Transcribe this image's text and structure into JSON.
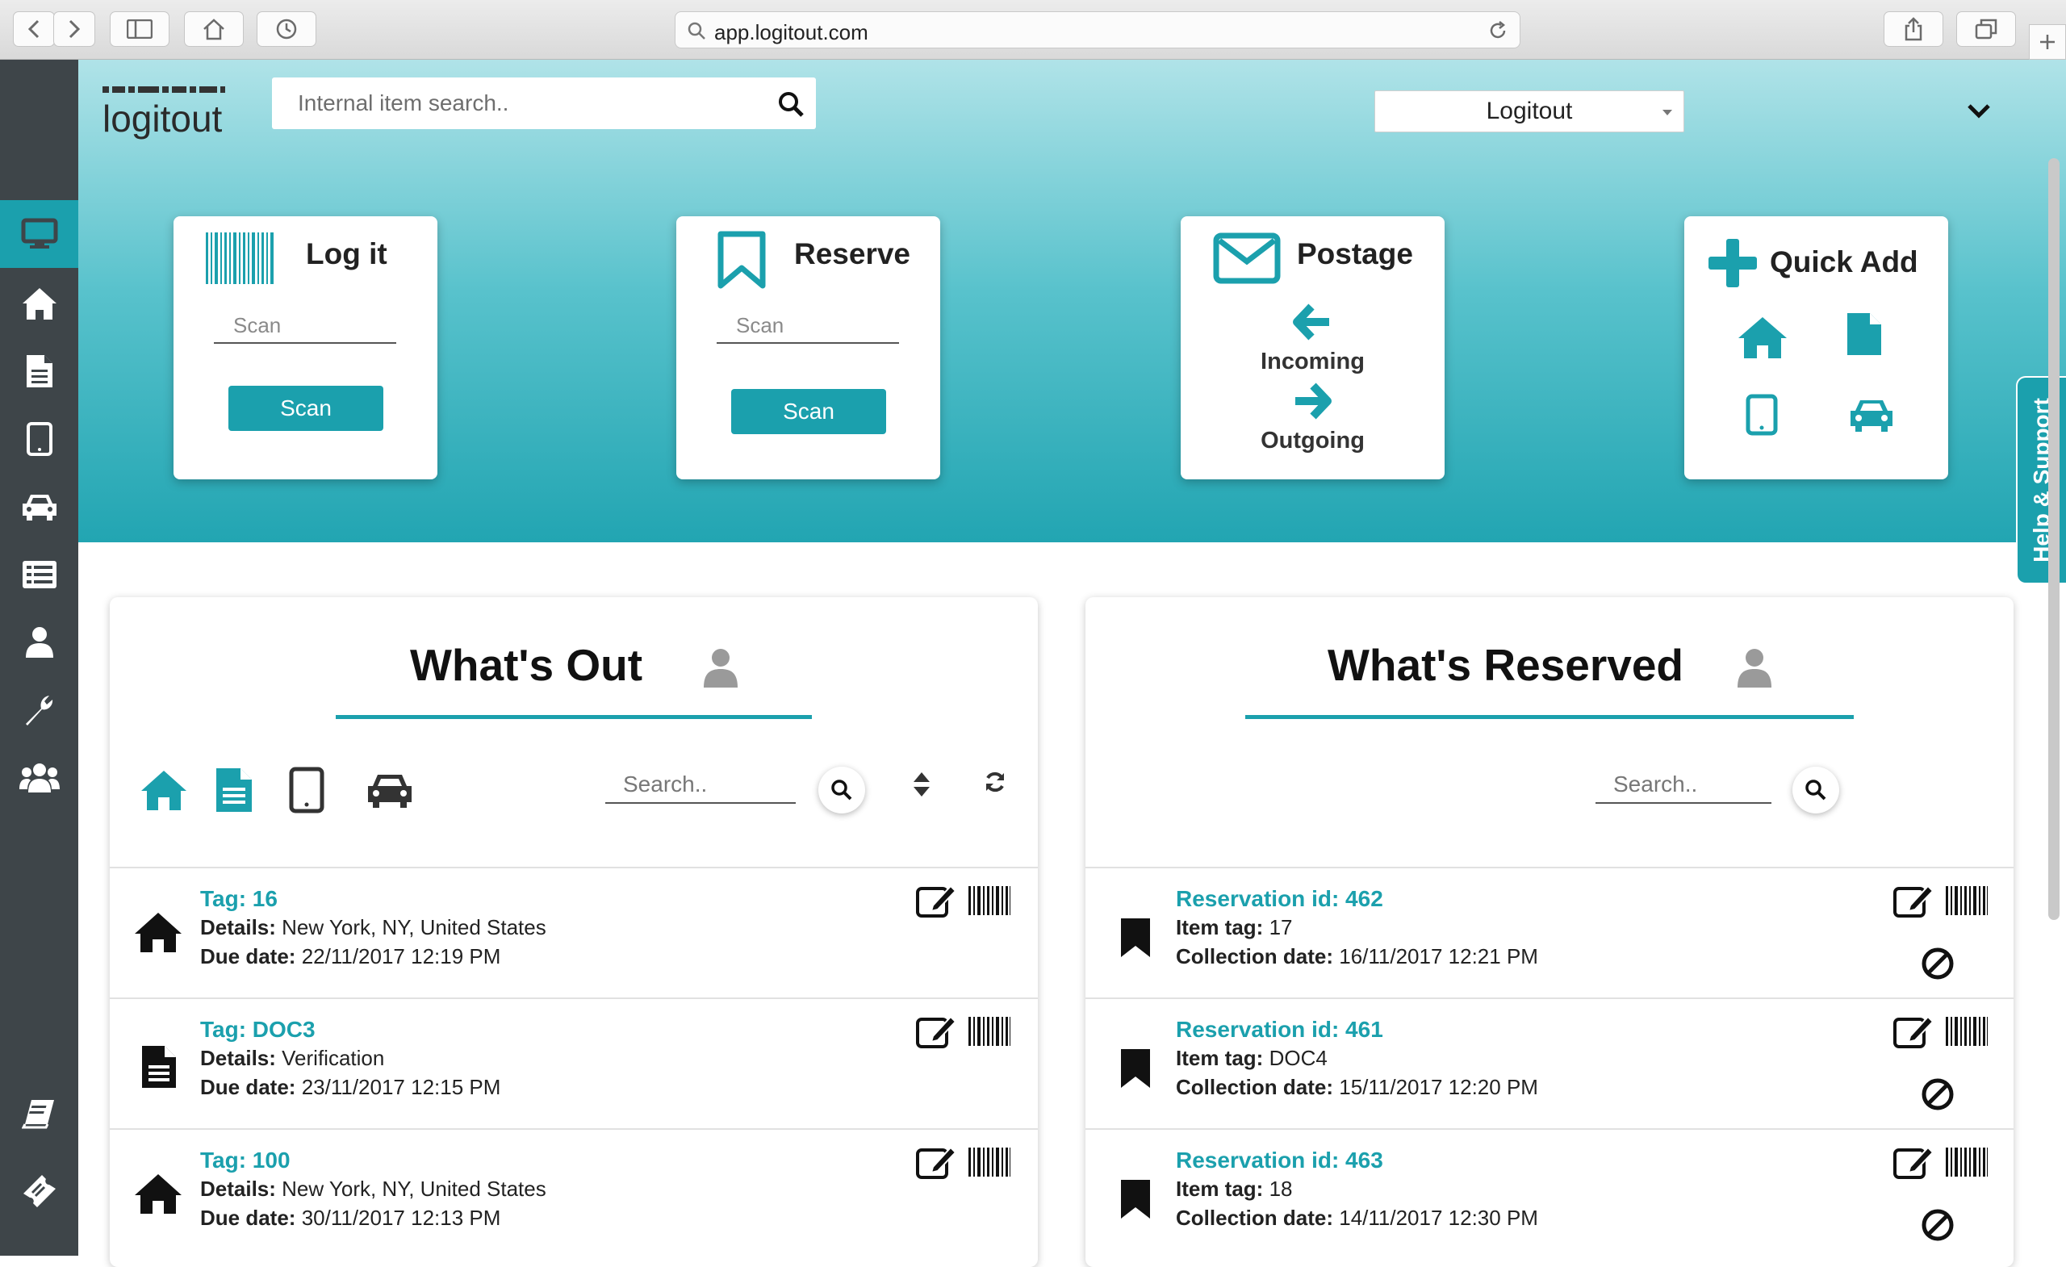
{
  "browser": {
    "url": "app.logitout.com"
  },
  "brand": {
    "logo_text": "logitout",
    "accent": "#1ba0ad",
    "rail_bg": "#3e4549"
  },
  "header": {
    "search_placeholder": "Internal item search..",
    "company_value": "Logitout"
  },
  "sidebar": {
    "items": [
      {
        "name": "dashboard",
        "icon": "monitor-icon",
        "active": true
      },
      {
        "name": "home",
        "icon": "home-icon"
      },
      {
        "name": "documents",
        "icon": "document-icon"
      },
      {
        "name": "devices",
        "icon": "tablet-icon"
      },
      {
        "name": "vehicles",
        "icon": "car-icon"
      },
      {
        "name": "list",
        "icon": "list-icon"
      },
      {
        "name": "user",
        "icon": "user-icon"
      },
      {
        "name": "settings",
        "icon": "wrench-icon"
      },
      {
        "name": "groups",
        "icon": "users-icon"
      },
      {
        "name": "guide",
        "icon": "book-icon"
      },
      {
        "name": "tickets",
        "icon": "ticket-icon"
      }
    ]
  },
  "cards": {
    "logit": {
      "title": "Log it",
      "input_placeholder": "Scan",
      "button": "Scan"
    },
    "reserve": {
      "title": "Reserve",
      "input_placeholder": "Scan",
      "button": "Scan"
    },
    "postage": {
      "title": "Postage",
      "incoming": "Incoming",
      "outgoing": "Outgoing"
    },
    "quickadd": {
      "title": "Quick Add"
    }
  },
  "help_tab": "Help & Support",
  "whats_out": {
    "title": "What's Out",
    "search_placeholder": "Search..",
    "items": [
      {
        "icon": "home-icon",
        "tag": "Tag: 16",
        "details_label": "Details:",
        "details": " New York, NY, United States",
        "due_label": "Due date:",
        "due": " 22/11/2017 12:19 PM"
      },
      {
        "icon": "document-icon",
        "tag": "Tag: DOC3",
        "details_label": "Details:",
        "details": " Verification",
        "due_label": "Due date:",
        "due": " 23/11/2017 12:15 PM"
      },
      {
        "icon": "home-icon",
        "tag": "Tag: 100",
        "details_label": "Details:",
        "details": " New York, NY, United States",
        "due_label": "Due date:",
        "due": " 30/11/2017 12:13 PM"
      }
    ]
  },
  "whats_reserved": {
    "title": "What's Reserved",
    "search_placeholder": "Search..",
    "items": [
      {
        "id": "Reservation id: 462",
        "tag_label": "Item tag:",
        "tag": " 17",
        "date_label": "Collection date:",
        "date": " 16/11/2017 12:21 PM"
      },
      {
        "id": "Reservation id: 461",
        "tag_label": "Item tag:",
        "tag": " DOC4",
        "date_label": "Collection date:",
        "date": " 15/11/2017 12:20 PM"
      },
      {
        "id": "Reservation id: 463",
        "tag_label": "Item tag:",
        "tag": " 18",
        "date_label": "Collection date:",
        "date": " 14/11/2017 12:30 PM"
      }
    ]
  }
}
